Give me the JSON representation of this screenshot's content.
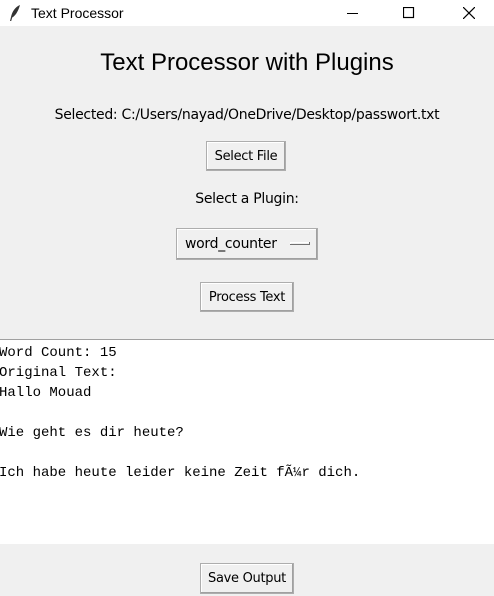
{
  "window": {
    "title": "Text Processor",
    "icon": "feather-icon"
  },
  "header": {
    "title": "Text Processor with Plugins"
  },
  "file": {
    "selected_text": "Selected: C:/Users/nayad/OneDrive/Desktop/passwort.txt",
    "select_button": "Select File"
  },
  "plugin": {
    "label": "Select a Plugin:",
    "selected": "word_counter",
    "process_button": "Process Text"
  },
  "output": {
    "lines": [
      "Word Count: 15",
      "Original Text:",
      "Hallo Mouad",
      "",
      "Wie geht es dir heute?",
      "",
      "Ich habe heute leider keine Zeit fÃ¼r dich."
    ],
    "save_button": "Save Output"
  }
}
